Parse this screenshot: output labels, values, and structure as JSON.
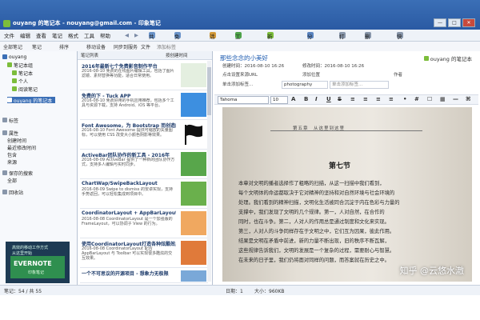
{
  "window": {
    "title": "ouyang 的笔记本 - nouyang@gmail.com - 印象笔记",
    "minimize": "—",
    "maximize": "□",
    "close": "✕"
  },
  "menu": {
    "items": [
      "文件",
      "编辑",
      "查看",
      "笔记",
      "格式",
      "工具",
      "帮助"
    ],
    "toolbar": {
      "back": "◀",
      "forward": "▶",
      "share": "共享",
      "account": "免费用户",
      "activity": "活动",
      "tags": "工作簿",
      "new_note": "新建笔记",
      "share_note": "分享",
      "print": "打印",
      "delete": "删除",
      "notebooks": "快乐秀"
    }
  },
  "subtoolbar": {
    "all_notes": "全部笔记",
    "notes": "笔记",
    "sort": "排序",
    "attach": "移动设备",
    "sync": "同步到服务",
    "file": "文件",
    "tag_field": "添加标签"
  },
  "sidebar": {
    "items": [
      {
        "label": "ouyang",
        "level": 0
      },
      {
        "label": "笔记本组",
        "level": 1
      },
      {
        "label": "笔记本",
        "level": 2
      },
      {
        "label": "个人",
        "level": 2
      },
      {
        "label": "阅读笔记",
        "level": 2
      },
      {
        "label": "ouyang 的笔记本",
        "level": 1
      },
      {
        "label": "标签",
        "level": 0
      },
      {
        "label": "属性",
        "level": 0
      },
      {
        "label": "创建时间",
        "level": 1
      },
      {
        "label": "最近修改时间",
        "level": 1
      },
      {
        "label": "包含",
        "level": 1
      },
      {
        "label": "来源",
        "level": 1
      },
      {
        "label": "保存的搜索",
        "level": 0
      },
      {
        "label": "全部",
        "level": 1
      },
      {
        "label": "回收站",
        "level": 0
      }
    ],
    "ad": {
      "line1": "高效的移动工作方式",
      "line2": "从这里开始",
      "brand": "EVERNOTE",
      "sub": "印象笔记"
    }
  },
  "note_list": {
    "header": "笔记列表",
    "sort_label": "按创建时间",
    "notes": [
      {
        "title": "2016年最新七个免费影音制作平台",
        "preview": "2016-08-10 免费的在线图片编辑工具，包括了图片滤镜、素材替换等功能，适合日常使用。",
        "color": "#e4efe0"
      },
      {
        "title": "免费的下 - Tuck APP",
        "preview": "2016-08-10 免费好用的手机应用推荐，包括多个工具与资源下载，支持 Android、iOS 等平台。",
        "color": "#3d8fe0"
      },
      {
        "title": "Font Awesome，为 Bootstrap 而创造的图标字体",
        "preview": "2016-08-10 Font Awesome 提供可缩放的矢量图标，可以使用 CSS 改变大小颜色阴影等效果。",
        "color": "#ffffff"
      },
      {
        "title": "ActiveBar团队协作的新工具 - 2016年",
        "preview": "2016-08-09 ActiveBar 提供了一种新的团队协作方式，支持多人编辑与实时同步。",
        "color": "#58a64b"
      },
      {
        "title": "ChartWap/SwipeBackLayout",
        "preview": "2016-08-09 Swipe to dismiss 的安卓实现，支持手势返回，可以轻松集成到项目中。",
        "color": "#6ab04c"
      },
      {
        "title": "CoordinatorLayout + AppBarLayout",
        "preview": "2016-08-08 CoordinatorLayout 是一个加强版的 FrameLayout，可以协调子 View 的行为。",
        "color": "#f0a860"
      },
      {
        "title": "使用CoordinatorLayout打造各种炫酷效果",
        "preview": "2016-08-08 CoordinatorLayout 配合 AppBarLayout 与 Toolbar 可以实现很多酷炫的交互效果。",
        "color": "#e07a3a"
      },
      {
        "title": "一个不可思议的开源项目 - 想象力无极限",
        "preview": "2016-08-07 推荐一个非常有趣的开源项目。",
        "color": "#7aa8d8"
      }
    ]
  },
  "editor": {
    "title": "那些念念的小美好",
    "notebook": "ouyang 的笔记本",
    "created_label": "创建时间：",
    "created_value": "2016-08-10 16:26",
    "updated_label": "修改时间：",
    "updated_value": "2016-08-10 16:26",
    "url_label": "点击设置来源URL",
    "tag_value": "photography",
    "tag_placeholder": "单击添加标签...",
    "location_label": "添加位置",
    "author_label": "作者",
    "font": "Tahoma",
    "font_size": "10",
    "doc": {
      "header": "第五章　从这里到这里",
      "section": "第七节",
      "lines": [
        "本章对文明的播者选择作了粗略的扫描，从这一扫描中我们看到，",
        "每个文明体的命运都取决于它对精神的坚持和对自然环境与社会环境的",
        "处理。我们看到的精神扫描，文明化生活被同合沉淀于内在色彩与力量的",
        "支撑中，我们发现了文明的几个规律。第一，人对自然，在合作的",
        "同时，也在斗争。第二，人对人的作用总是通过制度和文化来实现。",
        "第三，人对人的斗争同样存在于文明之中，它们互为因果，彼此作用。",
        "结果是文明在矛盾中前进，新的力量不断出现，旧的秩序不断瓦解，",
        "这些规律告诉我们，文明的发展是一个复杂的过程，需要耐心与智慧。",
        "在未来的日子里，我们仍将面对同样的问题，而答案就在历史之中。"
      ]
    },
    "watermark": "知乎 @云悠水澈"
  },
  "status": {
    "left": "笔记：54 / 共 55",
    "middle": "日期：1",
    "right": "大小：960KB"
  }
}
